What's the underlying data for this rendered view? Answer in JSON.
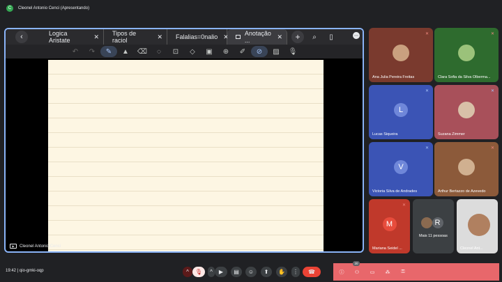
{
  "header": {
    "title": "Cleonel Antonio Cenci (Apresentando)",
    "badge": "C"
  },
  "browser": {
    "back_glyph": "‹",
    "tabs": [
      {
        "label": "Logica Aristate",
        "close": "✕"
      },
      {
        "label": "Tipos de raciol",
        "close": "✕"
      },
      {
        "label": "Falalias=0nalio",
        "close": "✕"
      },
      {
        "label": "Anotação ...",
        "close": "✕"
      }
    ],
    "new_tab_glyph": "+",
    "search_glyph": "⌕",
    "more_glyph": "⋯"
  },
  "toolbar": {
    "tools": [
      "↶",
      "↷",
      "✎",
      "▲",
      "⌫",
      "◌",
      "⊡",
      "◇",
      "▣",
      "⊕",
      "✐",
      "⊘",
      "▨",
      "🎙"
    ]
  },
  "presenter": {
    "label": "Cleonel Antonio Cenci"
  },
  "participants": [
    {
      "name": "Ana Julia Pereira Freitas",
      "mic": "✕",
      "bg": "#7a3a2e",
      "photo": "#c9a07f"
    },
    {
      "name": "Clara Sofia da Silva Olberma...",
      "mic": "✕",
      "bg": "#2e6b2e",
      "photo": "#9bc27a"
    },
    {
      "name": "Lucas Siqueira",
      "mic": "✕",
      "bg": "#3b54b5",
      "initial": "L",
      "avatar": "#6f87d9"
    },
    {
      "name": "Suzana Zimmer",
      "mic": "✕",
      "bg": "#a8505a",
      "photo": "#d8c0a8"
    },
    {
      "name": "Victoria Silva de Andrades",
      "mic": "✕",
      "bg": "#3b54b5",
      "initial": "V",
      "avatar": "#6f87d9"
    },
    {
      "name": "Arthur Bertazzo de Azevedo",
      "mic": "✕",
      "bg": "#8c5a3a",
      "photo": "#d0b090"
    },
    {
      "name": "Mariana Seidel ...",
      "mic": "✕",
      "bg": "#c0392b",
      "initial": "M",
      "avatar": "#e74c3c"
    },
    {
      "name": "Mais 11 pessoas",
      "mic": "",
      "bg": "#3c4043",
      "initial": "R",
      "avatar": "#5f6368"
    },
    {
      "name": "Cleonel Ant...",
      "mic": "",
      "bg": "#dcdcdc",
      "photo": "#b08060"
    }
  ],
  "meeting": {
    "time": "19:42",
    "separator": "|",
    "code": "qio-gmki-oqp"
  },
  "controls": {
    "raise": "^",
    "mic": "🎙",
    "cam_arrow": "^",
    "cam": "▶",
    "captions": "▤",
    "emoji": "☺",
    "present": "⬆",
    "hand": "✋",
    "more": "⋮",
    "end": "☎"
  },
  "side": {
    "info": "ⓘ",
    "people": "⚇",
    "chat": "▭",
    "activities": "⁂",
    "lock": "⚿",
    "people_count": "20"
  },
  "colors": {
    "accent": "#8ab4f8",
    "danger": "#ea4335",
    "panel": "#e8676b"
  }
}
